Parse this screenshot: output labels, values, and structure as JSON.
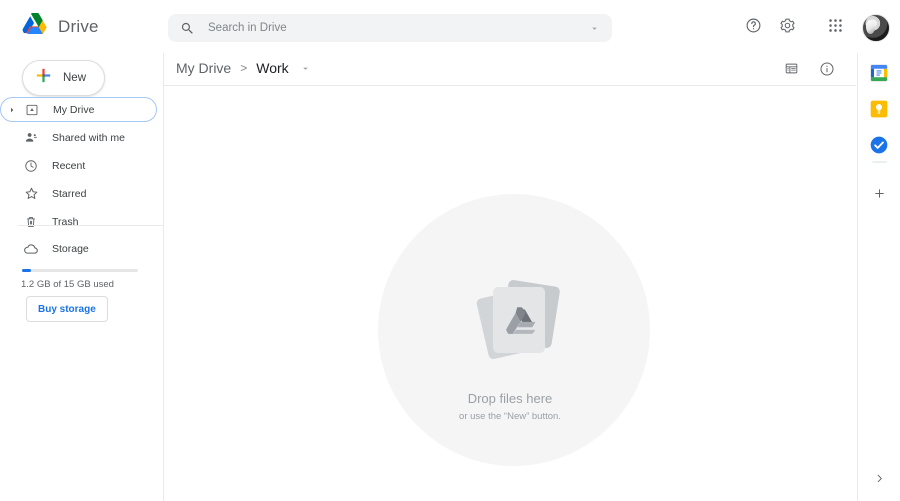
{
  "app": {
    "brand_name": "Drive",
    "logo_icon": "drive-triangle-logo"
  },
  "search": {
    "placeholder": "Search in Drive",
    "value": "",
    "icon": "search-icon",
    "options_icon": "chevron-down-icon"
  },
  "top_actions": {
    "help_icon": "help-circle-icon",
    "settings_icon": "gear-icon",
    "apps_icon": "apps-grid-icon",
    "avatar_icon": "user-avatar"
  },
  "sidebar": {
    "new_button": {
      "label": "New",
      "icon": "plus-multicolor-icon"
    },
    "items": [
      {
        "label": "My Drive",
        "icon": "my-drive-icon",
        "expandable": true,
        "focused": true
      },
      {
        "label": "Shared with me",
        "icon": "shared-people-icon",
        "expandable": false,
        "focused": false
      },
      {
        "label": "Recent",
        "icon": "clock-icon",
        "expandable": false,
        "focused": false
      },
      {
        "label": "Starred",
        "icon": "star-icon",
        "expandable": false,
        "focused": false
      },
      {
        "label": "Trash",
        "icon": "trash-icon",
        "expandable": false,
        "focused": false
      }
    ],
    "storage": {
      "label": "Storage",
      "icon": "cloud-icon",
      "usage_text": "1.2 GB of 15 GB used",
      "used_percent": 8,
      "bar_color": "#1a73e8",
      "buy_button_label": "Buy storage"
    }
  },
  "main": {
    "breadcrumb": {
      "parent": "My Drive",
      "separator": ">",
      "current": "Work",
      "caret_icon": "chevron-down-icon"
    },
    "view_actions": {
      "list_view_icon": "list-view-icon",
      "details_icon": "info-circle-icon"
    },
    "dropzone": {
      "title": "Drop files here",
      "subtitle": "or use the “New” button.",
      "illustration_icon": "stacked-files-drive-icon",
      "circle_color": "#f5f5f5"
    }
  },
  "right_rail": {
    "items": [
      {
        "icon": "google-calendar-icon",
        "color": "#4285f4"
      },
      {
        "icon": "google-keep-icon",
        "color": "#fbbc04"
      },
      {
        "icon": "google-tasks-icon",
        "color": "#1a73e8"
      }
    ],
    "add_icon": "plus-icon",
    "expand_icon": "chevron-right-icon"
  },
  "colors": {
    "accent_blue": "#1a73e8",
    "google_red": "#ea4335",
    "google_yellow": "#fbbc04",
    "google_green": "#34a853",
    "text_primary": "#202124",
    "text_secondary": "#5f6368",
    "divider": "#e8eaed"
  }
}
